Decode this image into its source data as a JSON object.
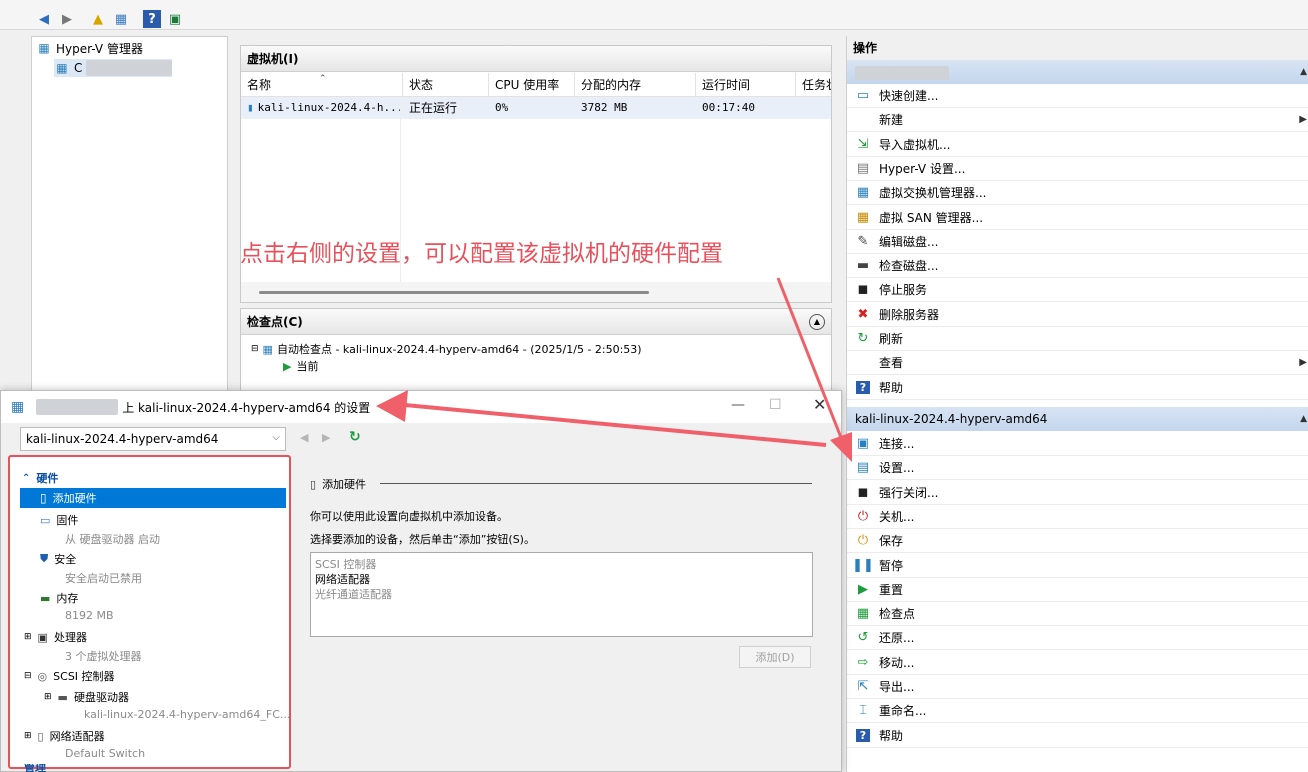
{
  "hyperv_tree": {
    "root": "Hyper-V 管理器",
    "host": "C"
  },
  "vm_panel": {
    "title": "虚拟机(I)",
    "columns": [
      "名称",
      "状态",
      "CPU 使用率",
      "分配的内存",
      "运行时间",
      "任务状"
    ],
    "rows": [
      [
        "kali-linux-2024.4-h...",
        "正在运行",
        "0%",
        "3782 MB",
        "00:17:40",
        ""
      ]
    ]
  },
  "checkpoint_panel": {
    "title": "检查点(C)",
    "item": "自动检查点 - kali-linux-2024.4-hyperv-amd64 - (2025/1/5 - 2:50:53)",
    "current": "当前"
  },
  "annotation": "点击右侧的设置，可以配置该虚拟机的硬件配置",
  "actions": {
    "header": "操作",
    "host_actions": [
      {
        "label": "快速创建...",
        "icon": "monitor-icon"
      },
      {
        "label": "新建",
        "icon": "none",
        "arrow": true
      },
      {
        "label": "导入虚拟机...",
        "icon": "import-icon"
      },
      {
        "label": "Hyper-V 设置...",
        "icon": "settings-doc-icon"
      },
      {
        "label": "虚拟交换机管理器...",
        "icon": "switch-icon"
      },
      {
        "label": "虚拟 SAN 管理器...",
        "icon": "san-icon"
      },
      {
        "label": "编辑磁盘...",
        "icon": "edit-disk-icon"
      },
      {
        "label": "检查磁盘...",
        "icon": "inspect-disk-icon"
      },
      {
        "label": "停止服务",
        "icon": "stop-icon"
      },
      {
        "label": "删除服务器",
        "icon": "delete-icon"
      },
      {
        "label": "刷新",
        "icon": "refresh-icon"
      },
      {
        "label": "查看",
        "icon": "none",
        "arrow": true
      },
      {
        "label": "帮助",
        "icon": "help-icon"
      }
    ],
    "vm_section": "kali-linux-2024.4-hyperv-amd64",
    "vm_actions": [
      {
        "label": "连接...",
        "icon": "connect-icon"
      },
      {
        "label": "设置...",
        "icon": "settings-icon"
      },
      {
        "label": "强行关闭...",
        "icon": "turnoff-icon"
      },
      {
        "label": "关机...",
        "icon": "shutdown-icon"
      },
      {
        "label": "保存",
        "icon": "save-icon"
      },
      {
        "label": "暂停",
        "icon": "pause-icon"
      },
      {
        "label": "重置",
        "icon": "reset-icon"
      },
      {
        "label": "检查点",
        "icon": "checkpoint-icon"
      },
      {
        "label": "还原...",
        "icon": "revert-icon"
      },
      {
        "label": "移动...",
        "icon": "move-icon"
      },
      {
        "label": "导出...",
        "icon": "export-icon"
      },
      {
        "label": "重命名...",
        "icon": "rename-icon"
      },
      {
        "label": "帮助",
        "icon": "help-icon"
      }
    ]
  },
  "settings_dialog": {
    "title": "上 kali-linux-2024.4-hyperv-amd64 的设置",
    "vm_select": "kali-linux-2024.4-hyperv-amd64",
    "hardware_header": "硬件",
    "items": [
      {
        "label": "添加硬件",
        "sub": ""
      },
      {
        "label": "固件",
        "sub": "从 硬盘驱动器 启动"
      },
      {
        "label": "安全",
        "sub": "安全启动已禁用"
      },
      {
        "label": "内存",
        "sub": "8192 MB"
      },
      {
        "label": "处理器",
        "sub": "3 个虚拟处理器"
      },
      {
        "label": "SCSI 控制器",
        "sub": ""
      },
      {
        "label": "硬盘驱动器",
        "sub": "kali-linux-2024.4-hyperv-amd64_FC..."
      },
      {
        "label": "网络适配器",
        "sub": "Default Switch"
      }
    ],
    "bottom_cut": "管理",
    "panel_title": "添加硬件",
    "desc1": "你可以使用此设置向虚拟机中添加设备。",
    "desc2": "选择要添加的设备，然后单击“添加”按钮(S)。",
    "devices": [
      "SCSI 控制器",
      "网络适配器",
      "光纤通道适配器"
    ],
    "add_button": "添加(D)"
  },
  "colors": {
    "accent": "#0078d7",
    "annotation": "#e8505b",
    "section": "#c9d9ee"
  }
}
